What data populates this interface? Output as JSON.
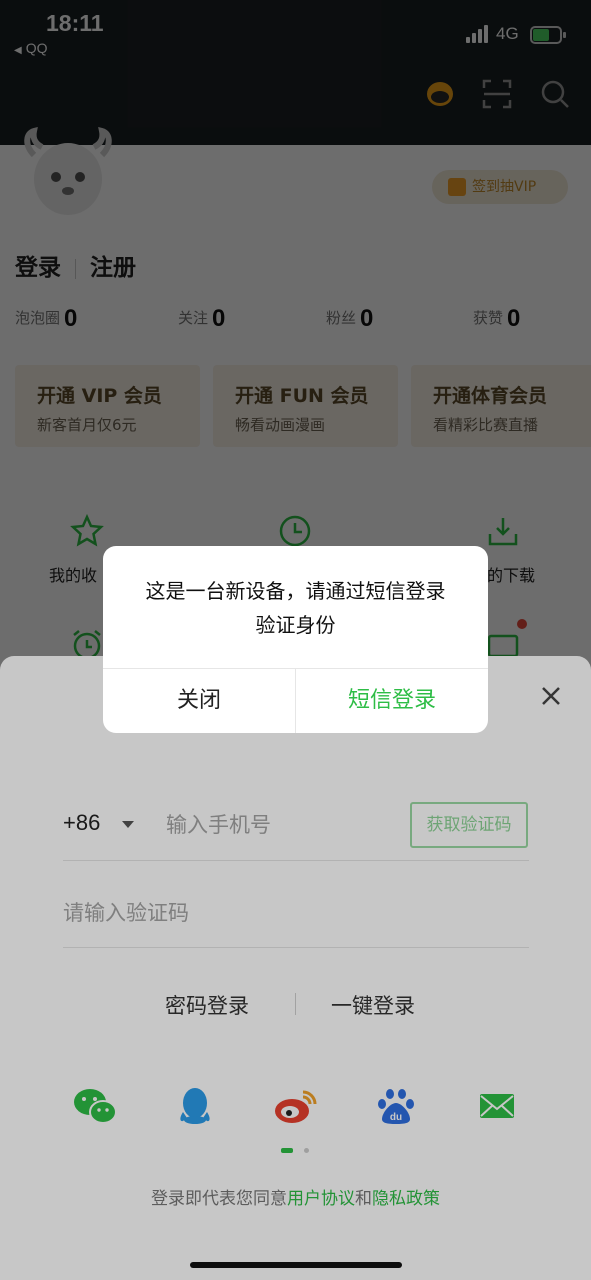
{
  "status_bar": {
    "time": "18:11",
    "back_app": "QQ",
    "network": "4G"
  },
  "header": {
    "vip_pill": "签到抽VIP"
  },
  "profile": {
    "login": "登录",
    "register": "注册"
  },
  "stats": [
    {
      "label": "泡泡圈",
      "value": "0"
    },
    {
      "label": "关注",
      "value": "0"
    },
    {
      "label": "粉丝",
      "value": "0"
    },
    {
      "label": "获赞",
      "value": "0"
    }
  ],
  "member_cards": [
    {
      "title": "开通 VIP 会员",
      "subtitle": "新客首月仅6元"
    },
    {
      "title": "开通 FUN 会员",
      "subtitle": "畅看动画漫画"
    },
    {
      "title": "开通体育会员",
      "subtitle": "看精彩比赛直播"
    }
  ],
  "grid": {
    "favorites_label": "我的收",
    "downloads_label": "的下载"
  },
  "login_sheet": {
    "country_code": "+86",
    "phone_placeholder": "输入手机号",
    "get_code": "获取验证码",
    "code_placeholder": "请输入验证码",
    "password_login": "密码登录",
    "one_click_login": "一键登录",
    "agreement_prefix": "登录即代表您同意",
    "user_agreement": "用户协议",
    "and": "和",
    "privacy_policy": "隐私政策",
    "social_icons": [
      "wechat-icon",
      "qq-icon",
      "weibo-icon",
      "baidu-icon",
      "email-icon"
    ]
  },
  "dialog": {
    "line1": "这是一台新设备，请通过短信登录",
    "line2": "验证身份",
    "close": "关闭",
    "sms_login": "短信登录"
  },
  "colors": {
    "accent": "#2ebd46",
    "vip_gold": "#c28a2c",
    "dark_header": "#1b1f22"
  }
}
